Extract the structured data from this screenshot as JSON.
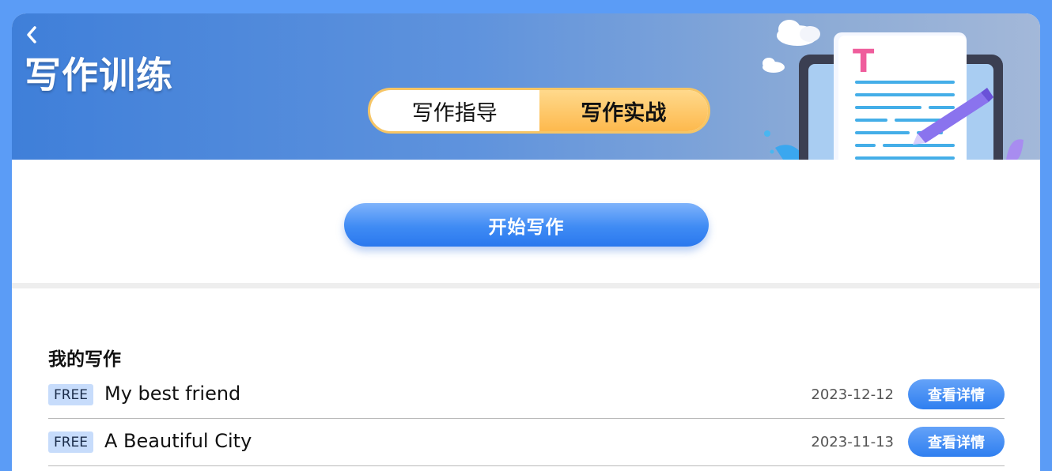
{
  "header": {
    "title": "写作训练",
    "back_icon": "chevron-left-icon",
    "tabs": [
      {
        "label": "写作指导",
        "active": false
      },
      {
        "label": "写作实战",
        "active": true
      }
    ],
    "illustration": "document-writing-illustration",
    "illustration_letter": "T"
  },
  "action": {
    "start_label": "开始写作"
  },
  "list": {
    "title": "我的写作",
    "items": [
      {
        "badge": "FREE",
        "title": "My best friend",
        "date": "2023-12-12",
        "action_label": "查看详情"
      },
      {
        "badge": "FREE",
        "title": "A Beautiful City",
        "date": "2023-11-13",
        "action_label": "查看详情"
      }
    ]
  },
  "colors": {
    "page_background": "#5b9cf6",
    "header_gradient_start": "#3f7fd9",
    "tab_active": "#fdb94d",
    "primary_button": "#2f7ff0",
    "badge_background": "#c7dcfb"
  }
}
